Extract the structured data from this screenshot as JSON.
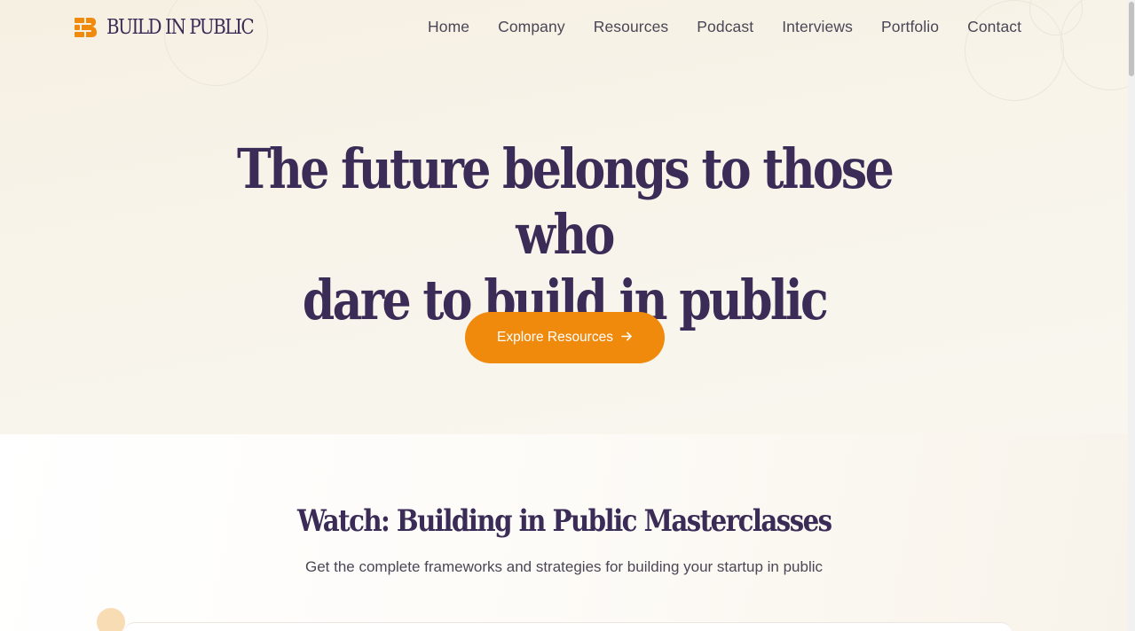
{
  "brand": {
    "name": "BUILD IN PUBLIC",
    "accent_color": "#f08a0c",
    "primary_text_color": "#3a2c57"
  },
  "nav": {
    "items": [
      {
        "label": "Home"
      },
      {
        "label": "Company"
      },
      {
        "label": "Resources"
      },
      {
        "label": "Podcast"
      },
      {
        "label": "Interviews"
      },
      {
        "label": "Portfolio"
      },
      {
        "label": "Contact"
      }
    ]
  },
  "hero": {
    "title_line1": "The future belongs to those who",
    "title_line2": "dare to build in public",
    "cta_label": "Explore Resources",
    "cta_icon": "arrow-right-icon"
  },
  "masterclasses": {
    "title": "Watch: Building in Public Masterclasses",
    "subtitle": "Get the complete frameworks and strategies for building your startup in public"
  }
}
